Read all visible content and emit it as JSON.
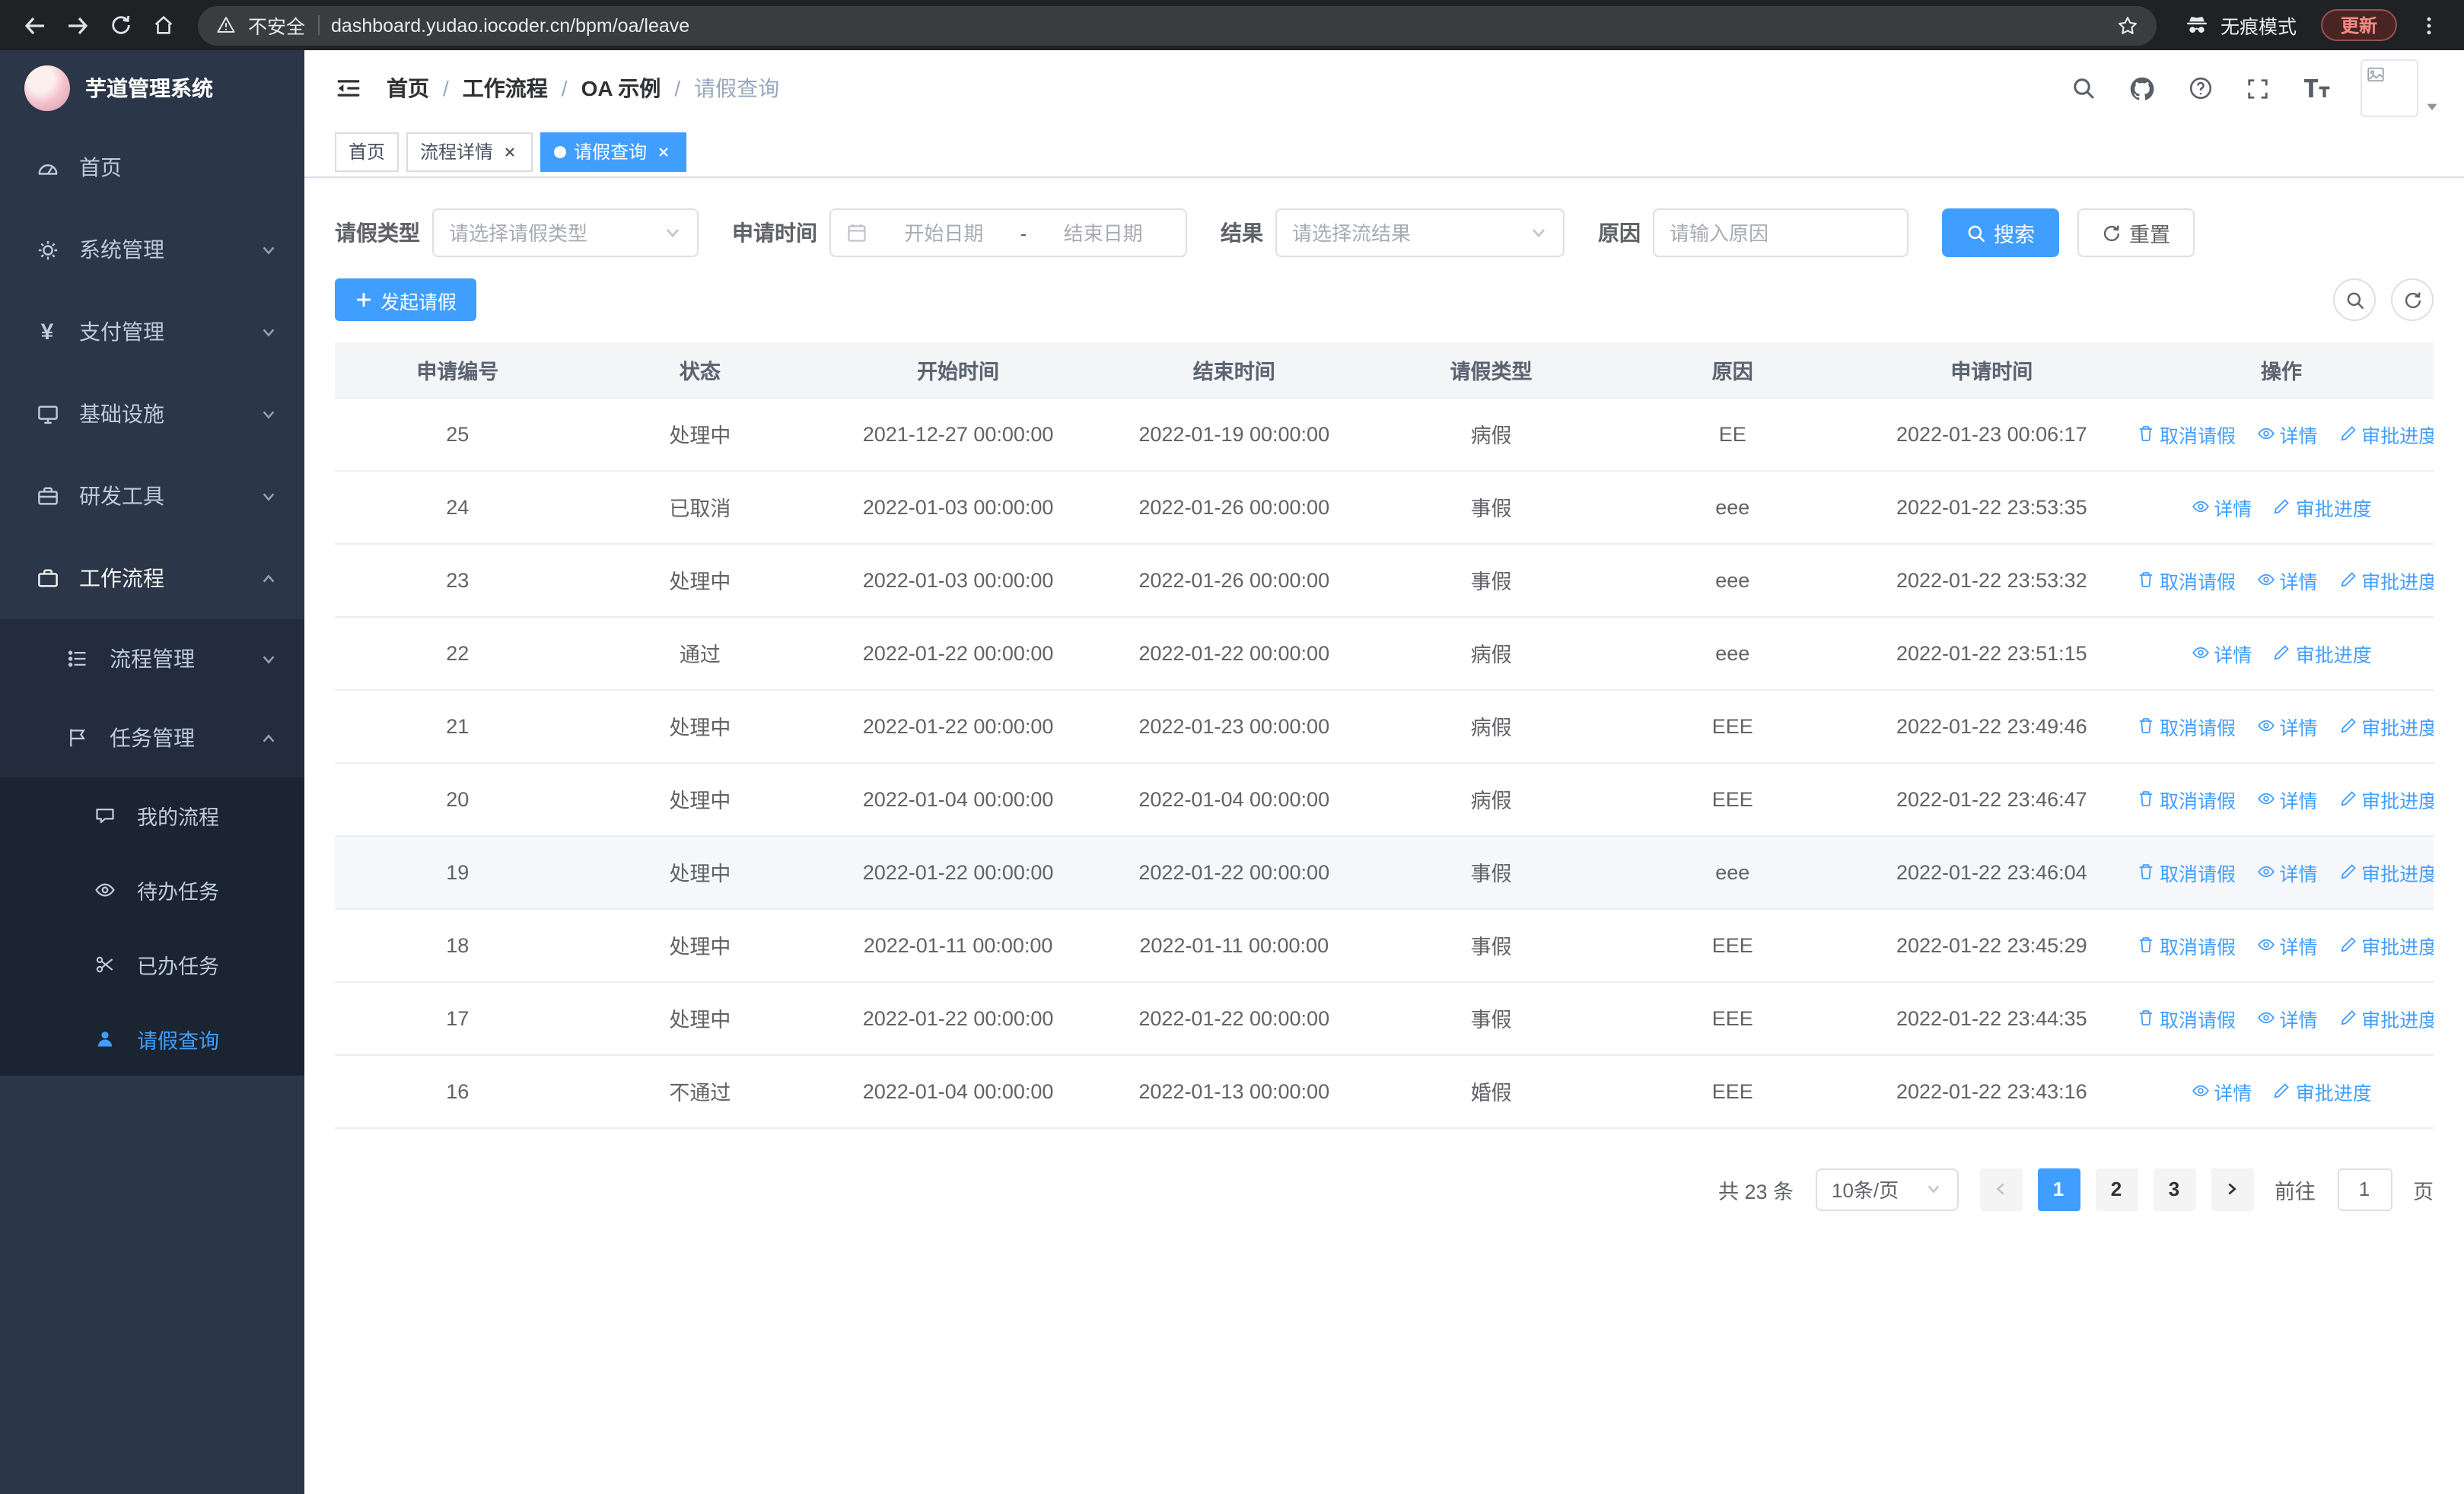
{
  "browser": {
    "security_label": "不安全",
    "url": "dashboard.yudao.iocoder.cn/bpm/oa/leave",
    "incognito_label": "无痕模式",
    "update_label": "更新"
  },
  "sidebar": {
    "app_title": "芋道管理系统",
    "menu": {
      "home": "首页",
      "system": "系统管理",
      "payment": "支付管理",
      "infra": "基础设施",
      "devtools": "研发工具",
      "workflow": "工作流程",
      "process_mgmt": "流程管理",
      "task_mgmt": "任务管理",
      "my_process": "我的流程",
      "todo_tasks": "待办任务",
      "done_tasks": "已办任务",
      "leave_query": "请假查询"
    }
  },
  "navbar": {
    "breadcrumb": [
      "首页",
      "工作流程",
      "OA 示例",
      "请假查询"
    ],
    "separator": "/"
  },
  "tabs": {
    "home": "首页",
    "process_detail": "流程详情",
    "leave_query": "请假查询"
  },
  "filters": {
    "leave_type_label": "请假类型",
    "leave_type_placeholder": "请选择请假类型",
    "apply_time_label": "申请时间",
    "start_placeholder": "开始日期",
    "range_separator": "-",
    "end_placeholder": "结束日期",
    "result_label": "结果",
    "result_placeholder": "请选择流结果",
    "reason_label": "原因",
    "reason_placeholder": "请输入原因",
    "search_button": "搜索",
    "reset_button": "重置"
  },
  "toolbar": {
    "create_button": "发起请假"
  },
  "table": {
    "columns": [
      "申请编号",
      "状态",
      "开始时间",
      "结束时间",
      "请假类型",
      "原因",
      "申请时间",
      "操作"
    ],
    "actions": {
      "cancel": "取消请假",
      "detail": "详情",
      "progress": "审批进度"
    },
    "rows": [
      {
        "id": "25",
        "status": "处理中",
        "start_time": "2021-12-27 00:00:00",
        "end_time": "2022-01-19 00:00:00",
        "leave_type": "病假",
        "reason": "EE",
        "apply_time": "2022-01-23 00:06:17",
        "cancellable": true
      },
      {
        "id": "24",
        "status": "已取消",
        "start_time": "2022-01-03 00:00:00",
        "end_time": "2022-01-26 00:00:00",
        "leave_type": "事假",
        "reason": "eee",
        "apply_time": "2022-01-22 23:53:35",
        "cancellable": false
      },
      {
        "id": "23",
        "status": "处理中",
        "start_time": "2022-01-03 00:00:00",
        "end_time": "2022-01-26 00:00:00",
        "leave_type": "事假",
        "reason": "eee",
        "apply_time": "2022-01-22 23:53:32",
        "cancellable": true
      },
      {
        "id": "22",
        "status": "通过",
        "start_time": "2022-01-22 00:00:00",
        "end_time": "2022-01-22 00:00:00",
        "leave_type": "病假",
        "reason": "eee",
        "apply_time": "2022-01-22 23:51:15",
        "cancellable": false
      },
      {
        "id": "21",
        "status": "处理中",
        "start_time": "2022-01-22 00:00:00",
        "end_time": "2022-01-23 00:00:00",
        "leave_type": "病假",
        "reason": "EEE",
        "apply_time": "2022-01-22 23:49:46",
        "cancellable": true
      },
      {
        "id": "20",
        "status": "处理中",
        "start_time": "2022-01-04 00:00:00",
        "end_time": "2022-01-04 00:00:00",
        "leave_type": "病假",
        "reason": "EEE",
        "apply_time": "2022-01-22 23:46:47",
        "cancellable": true
      },
      {
        "id": "19",
        "status": "处理中",
        "start_time": "2022-01-22 00:00:00",
        "end_time": "2022-01-22 00:00:00",
        "leave_type": "事假",
        "reason": "eee",
        "apply_time": "2022-01-22 23:46:04",
        "cancellable": true
      },
      {
        "id": "18",
        "status": "处理中",
        "start_time": "2022-01-11 00:00:00",
        "end_time": "2022-01-11 00:00:00",
        "leave_type": "事假",
        "reason": "EEE",
        "apply_time": "2022-01-22 23:45:29",
        "cancellable": true
      },
      {
        "id": "17",
        "status": "处理中",
        "start_time": "2022-01-22 00:00:00",
        "end_time": "2022-01-22 00:00:00",
        "leave_type": "事假",
        "reason": "EEE",
        "apply_time": "2022-01-22 23:44:35",
        "cancellable": true
      },
      {
        "id": "16",
        "status": "不通过",
        "start_time": "2022-01-04 00:00:00",
        "end_time": "2022-01-13 00:00:00",
        "leave_type": "婚假",
        "reason": "EEE",
        "apply_time": "2022-01-22 23:43:16",
        "cancellable": false
      }
    ]
  },
  "pagination": {
    "total_text": "共 23 条",
    "page_size": "10条/页",
    "pages": [
      "1",
      "2",
      "3"
    ],
    "active_page": "1",
    "goto_label": "前往",
    "goto_value": "1",
    "goto_unit": "页"
  },
  "colors": {
    "primary": "#409eff",
    "sidebar_bg": "#2b3648",
    "sidebar_submenu_bg": "#222c3c",
    "sidebar_deep_bg": "#1b2431",
    "chrome_bg": "#202124",
    "update_badge_text": "#f28b82"
  }
}
